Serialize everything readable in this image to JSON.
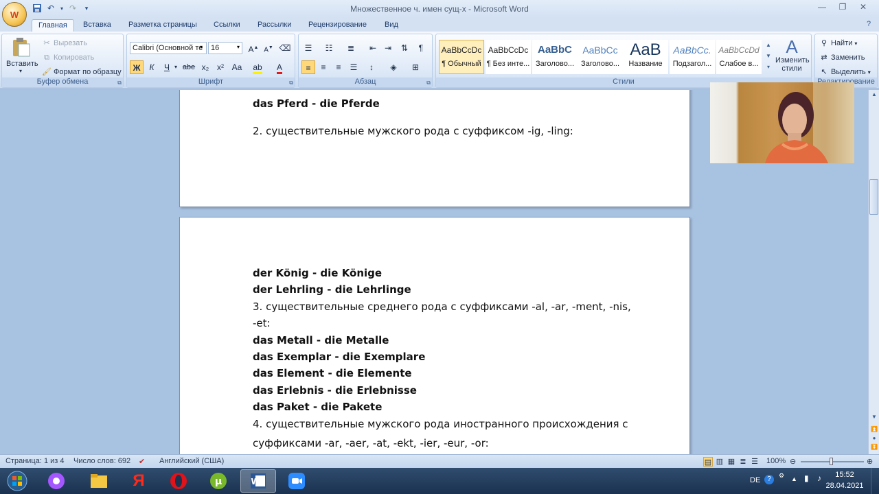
{
  "window": {
    "title": "Множественное ч. имен сущ-х - Microsoft Word",
    "office_button": "W"
  },
  "tabs": [
    "Главная",
    "Вставка",
    "Разметка страницы",
    "Ссылки",
    "Рассылки",
    "Рецензирование",
    "Вид"
  ],
  "ribbon": {
    "clipboard": {
      "label": "Буфер обмена",
      "paste": "Вставить",
      "cut": "Вырезать",
      "copy": "Копировать",
      "format_painter": "Формат по образцу"
    },
    "font": {
      "label": "Шрифт",
      "font_name": "Calibri (Основной те",
      "font_size": "16",
      "bold": "Ж",
      "italic": "К",
      "underline": "Ч",
      "strike": "abe",
      "subscript": "x₂",
      "superscript": "x²",
      "change_case": "Aa"
    },
    "paragraph": {
      "label": "Абзац"
    },
    "styles": {
      "label": "Стили",
      "items": [
        {
          "sample": "AaBbCcDc",
          "name": "¶ Обычный"
        },
        {
          "sample": "AaBbCcDc",
          "name": "¶ Без инте..."
        },
        {
          "sample": "AaBbC",
          "name": "Заголово..."
        },
        {
          "sample": "AaBbCc",
          "name": "Заголово..."
        },
        {
          "sample": "AaB",
          "name": "Название"
        },
        {
          "sample": "AaBbCc.",
          "name": "Подзагол..."
        },
        {
          "sample": "AaBbCcDd",
          "name": "Слабое в..."
        }
      ],
      "change_styles": "Изменить стили"
    },
    "editing": {
      "label": "Редактирование",
      "find": "Найти",
      "replace": "Заменить",
      "select": "Выделить"
    }
  },
  "document": {
    "page1_lines": [
      {
        "text": "das Pferd - die Pferde",
        "bold": true
      },
      {
        "text": "2. существительные  мужского рода с суффиксом -ig, -ling:",
        "bold": false
      }
    ],
    "page2_lines": [
      {
        "text": "der König - die Könige",
        "bold": true
      },
      {
        "text": "der Lehrling - die Lehrlinge",
        "bold": true
      },
      {
        "text": "3. существительные  среднего  рода с суффиксами -al, -ar, -ment, -nis,",
        "bold": false
      },
      {
        "text": "-et:",
        "bold": false
      },
      {
        "text": "das Metall - die Metalle",
        "bold": true
      },
      {
        "text": "das Exemplar - die Exemplare",
        "bold": true
      },
      {
        "text": "das Element - die Elemente",
        "bold": true
      },
      {
        "text": "das Erlebnis - die Erlebnisse",
        "bold": true
      },
      {
        "text": "das Paket - die Pakete",
        "bold": true
      },
      {
        "text": "4. существительные  мужского рода иностранного  происхождения с",
        "bold": false
      },
      {
        "text": "суффиксами -ar, -aer, -at, -ekt, -ier, -eur, -or:",
        "bold": false
      }
    ]
  },
  "statusbar": {
    "page": "Страница: 1 из 4",
    "words": "Число слов: 692",
    "language": "Английский (США)",
    "zoom": "100%"
  },
  "taskbar": {
    "lang": "DE",
    "time": "15:52",
    "date": "28.04.2021",
    "apps": [
      "windows-explorer",
      "alice",
      "files",
      "yandex",
      "opera",
      "utorrent",
      "word",
      "zoom"
    ]
  },
  "colors": {
    "ribbon_bg": "#dbe7f6",
    "doc_bg": "#a8c2e2",
    "taskbar": "#1b3250",
    "accent": "#15428b"
  }
}
